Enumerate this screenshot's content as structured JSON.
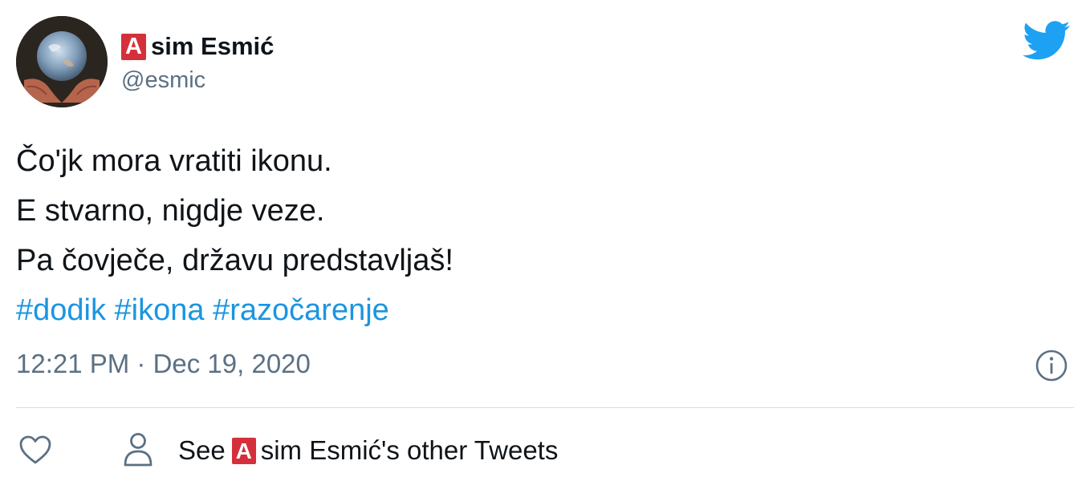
{
  "author": {
    "name_badge": "A",
    "name_rest": "sim Esmić",
    "handle": "@esmic",
    "badge_color": "#d4303b"
  },
  "tweet": {
    "lines": [
      "Čo'jk mora vratiti ikonu.",
      "E stvarno, nigdje veze.",
      "Pa čovječe, državu predstavljaš!"
    ],
    "hashtags": [
      "#dodik",
      "#ikona",
      "#razočarenje"
    ],
    "timestamp": "12:21 PM · Dec 19, 2020"
  },
  "footer": {
    "see_prefix": "See",
    "see_badge": "A",
    "see_suffix": "sim Esmić's other Tweets"
  },
  "icons": {
    "brand": "twitter-bird-icon",
    "info": "info-icon",
    "like": "heart-icon",
    "profile": "person-icon"
  },
  "colors": {
    "link": "#1b95e0",
    "brand": "#1da1f2",
    "secondary_text": "#5b7083"
  }
}
